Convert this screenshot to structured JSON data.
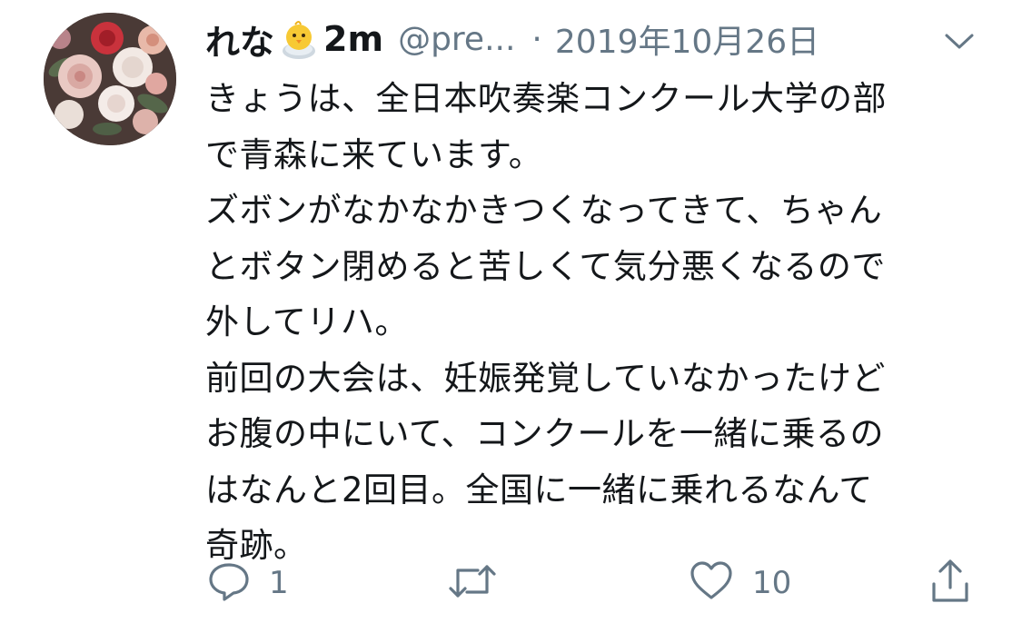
{
  "tweet": {
    "display_name": "れな",
    "name_suffix": "2m",
    "handle": "@pre...",
    "separator": "·",
    "date": "2019年10月26日",
    "text": "きょうは、全日本吹奏楽コンクール大学の部\nで青森に来ています。\nズボンがなかなかきつくなってきて、ちゃん\nとボタン閉めると苦しくて気分悪くなるので\n外してリハ。\n前回の大会は、妊娠発覚していなかったけど\nお腹の中にいて、コンクールを一緒に乗るの\nはなんと2回目。全国に一緒に乗れるなんて\n奇跡。",
    "emoji_icon": "baby-chick-emoji",
    "avatar_icon": "flower-bouquet-avatar"
  },
  "actions": {
    "reply_count": "1",
    "retweet_count": "",
    "like_count": "10",
    "share_count": ""
  },
  "colors": {
    "text": "#14171a",
    "secondary": "#657786",
    "icon": "#657786",
    "background": "#ffffff"
  }
}
